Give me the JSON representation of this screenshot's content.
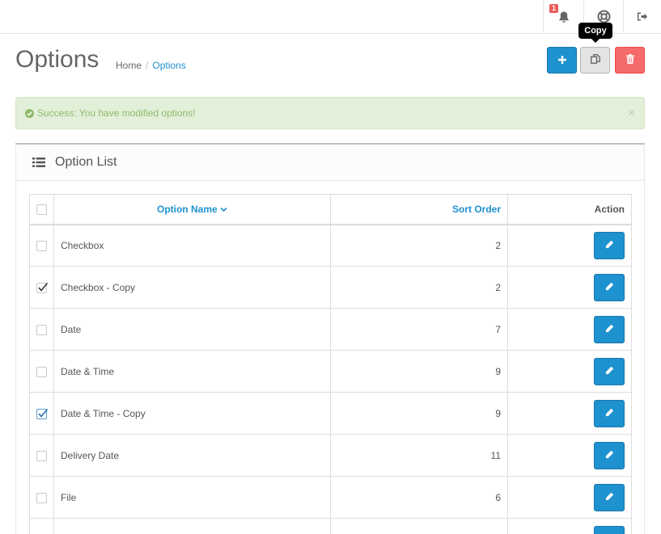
{
  "header": {
    "notification_count": "1",
    "icons": [
      "bell-icon",
      "life-ring-icon",
      "sign-out-icon"
    ]
  },
  "tooltip": {
    "text": "Copy"
  },
  "page": {
    "title": "Options",
    "breadcrumb": {
      "home": "Home",
      "separator": "/",
      "current": "Options"
    }
  },
  "alert": {
    "message": "Success: You have modified options!",
    "close": "×"
  },
  "panel": {
    "title": "Option List"
  },
  "table": {
    "headers": {
      "name": "Option Name",
      "sort": "Sort Order",
      "action": "Action"
    },
    "rows": [
      {
        "name": "Checkbox",
        "sort": "2",
        "checked": false
      },
      {
        "name": "Checkbox - Copy",
        "sort": "2",
        "checked": true
      },
      {
        "name": "Date",
        "sort": "7",
        "checked": false
      },
      {
        "name": "Date & Time",
        "sort": "9",
        "checked": false
      },
      {
        "name": "Date & Time - Copy",
        "sort": "9",
        "checked": true
      },
      {
        "name": "Delivery Date",
        "sort": "11",
        "checked": false
      },
      {
        "name": "File",
        "sort": "6",
        "checked": false
      },
      {
        "name": "",
        "sort": "",
        "checked": false
      }
    ]
  },
  "colors": {
    "primary": "#1e91cf",
    "danger": "#f56b6b",
    "success_bg": "#e2efd9",
    "success_text": "#8fbb6c",
    "badge": "#e95b5b"
  }
}
